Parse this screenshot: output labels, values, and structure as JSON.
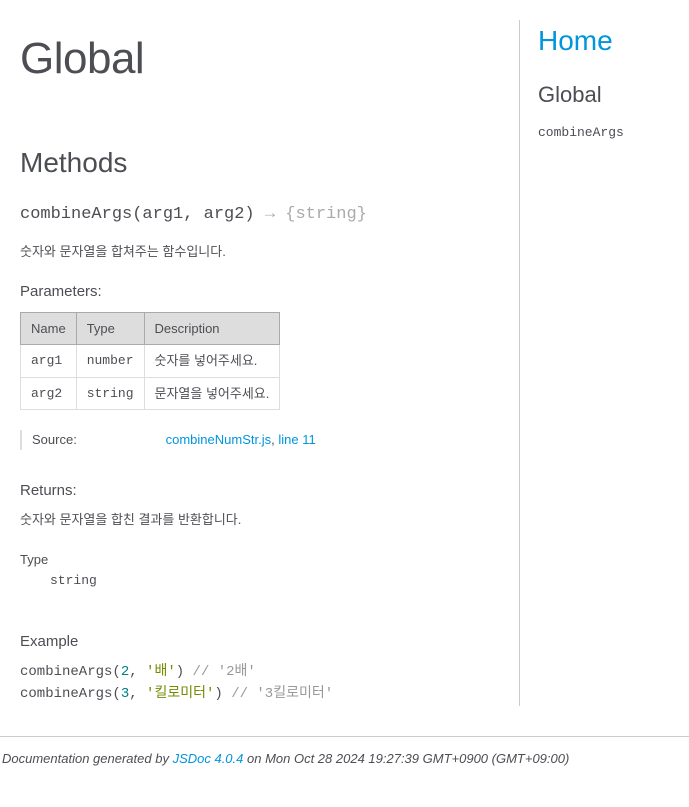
{
  "page": {
    "title": "Global",
    "methodsHeading": "Methods"
  },
  "method": {
    "name": "combineArgs",
    "signature": "(arg1, arg2)",
    "arrow": " → ",
    "returnTypeBraced": "{string}",
    "description": "숫자와 문자열을 합쳐주는 함수입니다.",
    "parametersLabel": "Parameters:",
    "paramsHeader": {
      "name": "Name",
      "type": "Type",
      "desc": "Description"
    },
    "params": [
      {
        "name": "arg1",
        "type": "number",
        "desc": "숫자를 넣어주세요."
      },
      {
        "name": "arg2",
        "type": "string",
        "desc": "문자열을 넣어주세요."
      }
    ],
    "sourceLabel": "Source:",
    "sourceFile": "combineNumStr.js",
    "sourceSep": ", ",
    "sourceLine": "line 11",
    "returnsLabel": "Returns:",
    "returnsDesc": "숫자와 문자열을 합친 결과를 반환합니다.",
    "returnsTypeLabel": "Type",
    "returnsType": "string",
    "exampleLabel": "Example",
    "example": {
      "line1": {
        "fn": "combineArgs(",
        "n": "2",
        "c1": ", ",
        "s": "'배'",
        "c2": ") ",
        "com": "// '2배'"
      },
      "line2": {
        "fn": "combineArgs(",
        "n": "3",
        "c1": ", ",
        "s": "'킬로미터'",
        "c2": ") ",
        "com": "// '3킬로미터'"
      }
    }
  },
  "nav": {
    "home": "Home",
    "globalHeading": "Global",
    "items": [
      "combineArgs"
    ]
  },
  "footer": {
    "prefix": "Documentation generated by ",
    "link": "JSDoc 4.0.4",
    "suffix": " on Mon Oct 28 2024 19:27:39 GMT+0900 (GMT+09:00)"
  }
}
